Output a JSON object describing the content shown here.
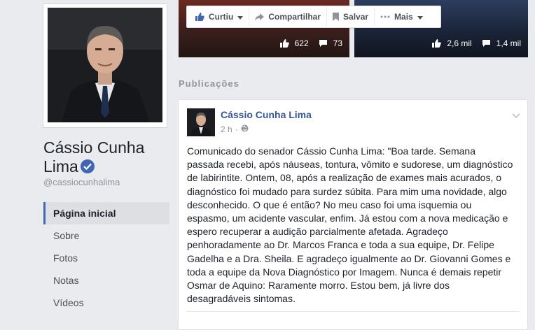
{
  "profile": {
    "name": "Cássio Cunha Lima",
    "handle": "@cassiocunhalima"
  },
  "nav": {
    "items": [
      {
        "label": "Página inicial",
        "active": true
      },
      {
        "label": "Sobre",
        "active": false
      },
      {
        "label": "Fotos",
        "active": false
      },
      {
        "label": "Notas",
        "active": false
      },
      {
        "label": "Vídeos",
        "active": false
      }
    ]
  },
  "actions": {
    "like": "Curtiu",
    "share": "Compartilhar",
    "save": "Salvar",
    "more": "Mais"
  },
  "media": {
    "left": {
      "likes": "622",
      "comments": "73"
    },
    "right": {
      "likes": "2,6 mil",
      "comments": "1,4 mil"
    }
  },
  "section": {
    "title": "Publicações"
  },
  "post": {
    "author": "Cássio Cunha Lima",
    "time": "2 h",
    "text": "Comunicado do senador Cássio Cunha Lima: \"Boa tarde. Semana\npassada recebi, após náuseas, tontura, vômito e sudorese, um diagnóstico\nde labirintite. Ontem, 08, após a realização de exames mais acurados, o\ndiagnóstico foi mudado para surdez súbita. Para mim uma novidade, algo\ndesconhecido. O que é então? No meu caso foi uma isquemia ou\nespasmo, um acidente vascular, enfim. Já estou com a nova medicação e\nespero recuperar a audição parcialmente afetada. Agradeço\npenhoradamente ao Dr. Marcos Franca e toda a sua equipe, Dr. Felipe\nGadelha e a Dra. Sheila. E agradeço igualmente ao Dr. Giovanni Gomes e\ntoda a equipe da Nova Diagnóstico por Imagem. Nunca é demais repetir\nOsmar de Aquino: Raramente morro. Estou bem, já livre dos\ndesagradáveis sintomas."
  },
  "colors": {
    "accent": "#4267b2",
    "link": "#365899",
    "background": "#e9ebee"
  }
}
